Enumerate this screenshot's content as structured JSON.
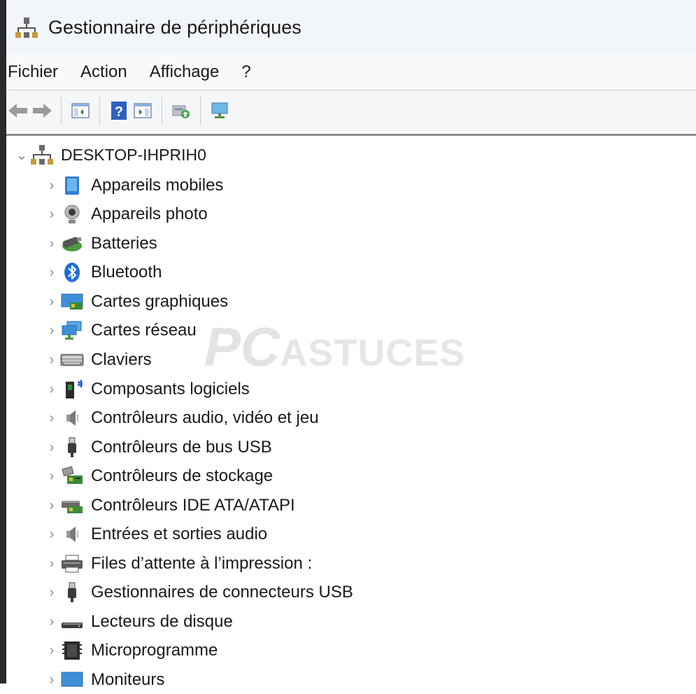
{
  "window": {
    "title": "Gestionnaire de périphériques"
  },
  "menu": [
    "Fichier",
    "Action",
    "Affichage",
    "?"
  ],
  "toolbar": {
    "buttons": [
      "back-arrow-icon",
      "forward-arrow-icon",
      "show-hide-console-tree-icon",
      "help-icon",
      "action-pane-icon",
      "update-driver-icon",
      "display-monitor-icon"
    ]
  },
  "tree": {
    "root": {
      "label": "DESKTOP-IHPRIH0",
      "icon": "computer-network-icon",
      "expanded": true
    },
    "items": [
      {
        "label": "Appareils mobiles",
        "icon": "mobile-device-icon"
      },
      {
        "label": "Appareils photo",
        "icon": "webcam-icon"
      },
      {
        "label": "Batteries",
        "icon": "battery-icon"
      },
      {
        "label": "Bluetooth",
        "icon": "bluetooth-icon"
      },
      {
        "label": "Cartes graphiques",
        "icon": "display-adapter-icon"
      },
      {
        "label": "Cartes réseau",
        "icon": "network-adapter-icon"
      },
      {
        "label": "Claviers",
        "icon": "keyboard-icon"
      },
      {
        "label": "Composants logiciels",
        "icon": "software-component-icon"
      },
      {
        "label": "Contrôleurs audio, vidéo et jeu",
        "icon": "speaker-icon"
      },
      {
        "label": "Contrôleurs de bus USB",
        "icon": "usb-plug-icon"
      },
      {
        "label": "Contrôleurs de stockage",
        "icon": "storage-controller-icon"
      },
      {
        "label": "Contrôleurs IDE ATA/ATAPI",
        "icon": "ide-controller-icon"
      },
      {
        "label": "Entrées et sorties audio",
        "icon": "speaker-icon"
      },
      {
        "label": "Files d’attente à l’impression :",
        "icon": "printer-icon"
      },
      {
        "label": "Gestionnaires de connecteurs USB",
        "icon": "usb-plug-icon"
      },
      {
        "label": "Lecteurs de disque",
        "icon": "disk-drive-icon"
      },
      {
        "label": "Microprogramme",
        "icon": "firmware-chip-icon"
      },
      {
        "label": "Moniteurs",
        "icon": "monitor-icon"
      }
    ]
  },
  "watermark": {
    "part1": "PC",
    "part2": "ASTUCES"
  },
  "colors": {
    "titlebar": "#f2f5f9",
    "menubar": "#f8f9fb",
    "toolbar": "#f5f6f8",
    "chevron": "#8a8a8a"
  }
}
